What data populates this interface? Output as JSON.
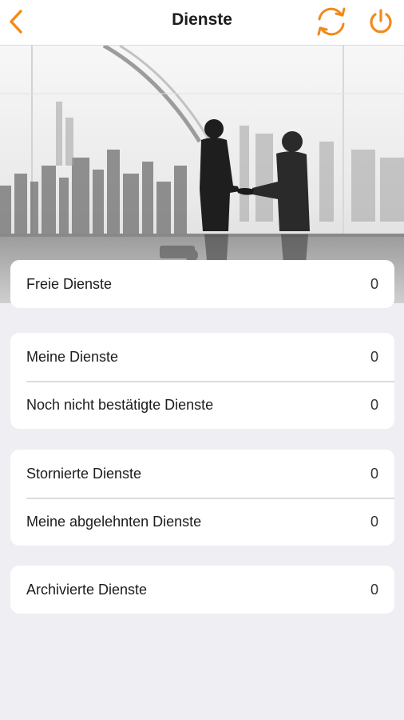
{
  "header": {
    "title": "Dienste",
    "back_icon": "chevron-left-icon",
    "refresh_icon": "refresh-icon",
    "power_icon": "power-icon",
    "accent_color": "#f08a1c"
  },
  "hero": {
    "image_subject": "business-handshake-photo"
  },
  "groups": [
    {
      "rows": [
        {
          "label": "Freie Dienste",
          "count": "0"
        }
      ]
    },
    {
      "rows": [
        {
          "label": "Meine Dienste",
          "count": "0"
        },
        {
          "label": "Noch nicht bestätigte Dienste",
          "count": "0"
        }
      ]
    },
    {
      "rows": [
        {
          "label": "Stornierte Dienste",
          "count": "0"
        },
        {
          "label": "Meine abgelehnten Dienste",
          "count": "0"
        }
      ]
    },
    {
      "rows": [
        {
          "label": "Archivierte Dienste",
          "count": "0"
        }
      ]
    }
  ]
}
